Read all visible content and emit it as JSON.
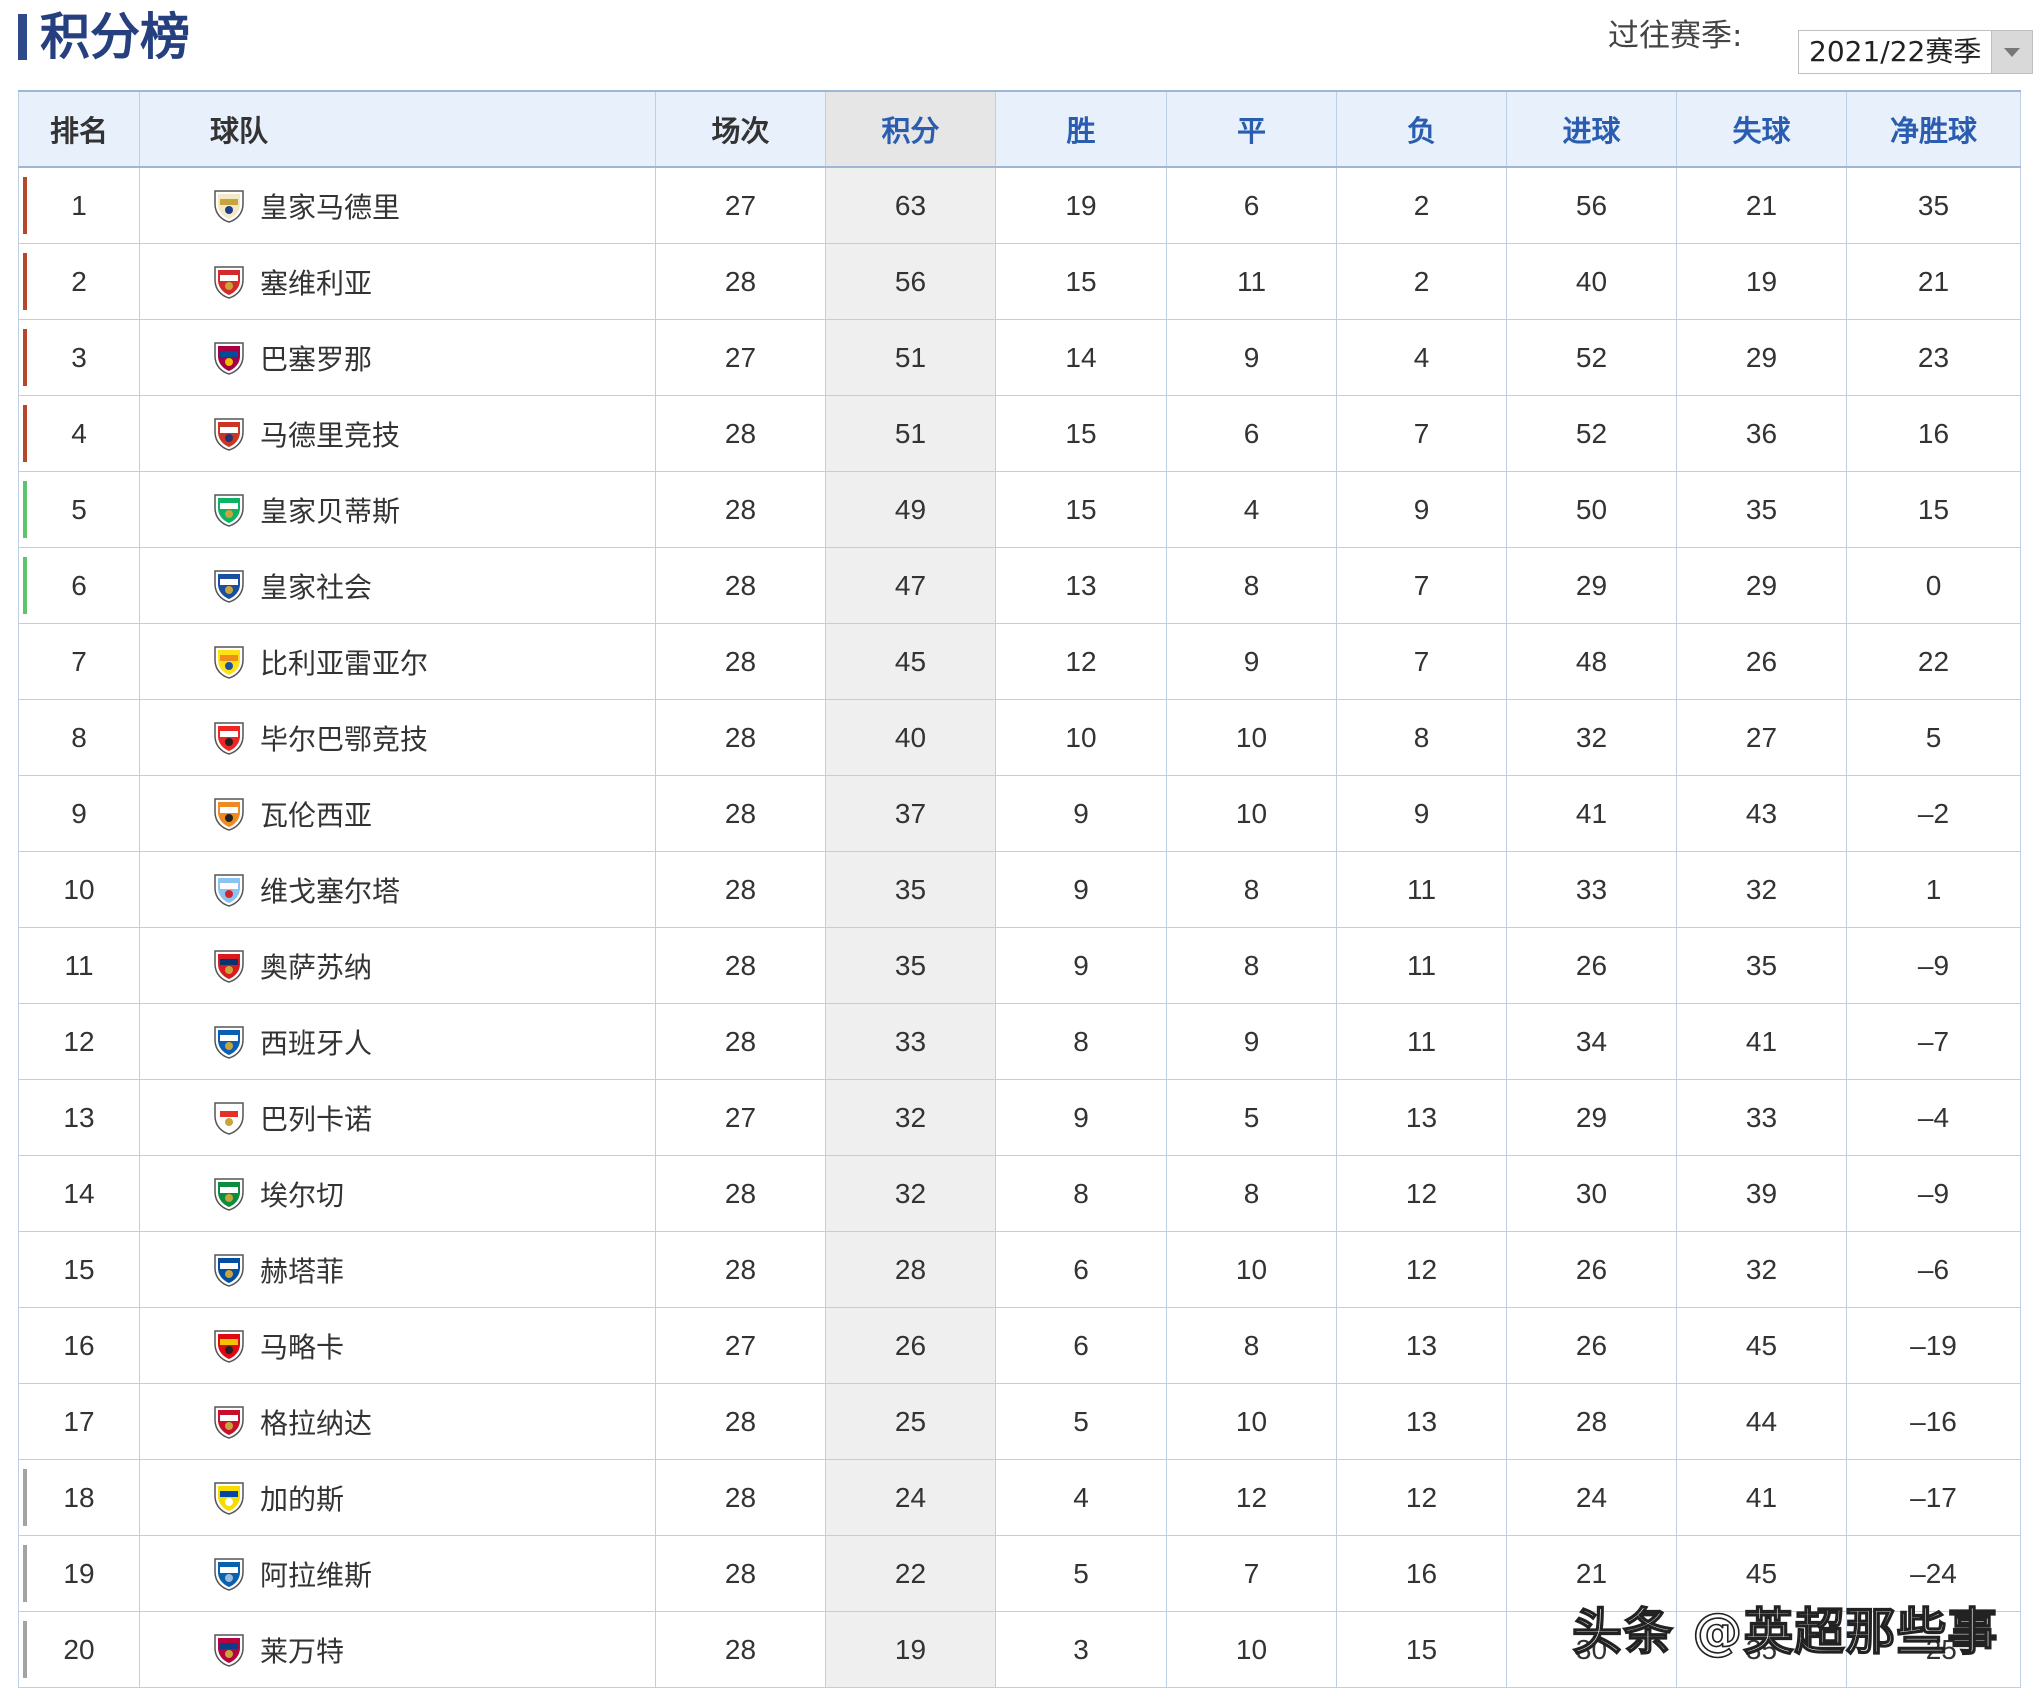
{
  "page": {
    "title": "积分榜",
    "season_label": "过往赛季:",
    "season_value": "2021/22赛季",
    "watermark": "头条 @英超那些事"
  },
  "colors": {
    "ucl": "#b5482b",
    "europa": "#5cc46a",
    "relegation": "#a3a3a3",
    "header_text": "#2a5db0",
    "title": "#253f7f"
  },
  "headers": [
    "排名",
    "球队",
    "场次",
    "积分",
    "胜",
    "平",
    "负",
    "进球",
    "失球",
    "净胜球"
  ],
  "rows": [
    {
      "rank": "1",
      "team": "皇家马德里",
      "played": "27",
      "pts": "63",
      "w": "19",
      "d": "6",
      "l": "2",
      "gf": "56",
      "ga": "21",
      "gd": "35",
      "zone": "ucl",
      "crest": "real-madrid-crest"
    },
    {
      "rank": "2",
      "team": "塞维利亚",
      "played": "28",
      "pts": "56",
      "w": "15",
      "d": "11",
      "l": "2",
      "gf": "40",
      "ga": "19",
      "gd": "21",
      "zone": "ucl",
      "crest": "sevilla-crest"
    },
    {
      "rank": "3",
      "team": "巴塞罗那",
      "played": "27",
      "pts": "51",
      "w": "14",
      "d": "9",
      "l": "4",
      "gf": "52",
      "ga": "29",
      "gd": "23",
      "zone": "ucl",
      "crest": "barcelona-crest"
    },
    {
      "rank": "4",
      "team": "马德里竞技",
      "played": "28",
      "pts": "51",
      "w": "15",
      "d": "6",
      "l": "7",
      "gf": "52",
      "ga": "36",
      "gd": "16",
      "zone": "ucl",
      "crest": "atletico-crest"
    },
    {
      "rank": "5",
      "team": "皇家贝蒂斯",
      "played": "28",
      "pts": "49",
      "w": "15",
      "d": "4",
      "l": "9",
      "gf": "50",
      "ga": "35",
      "gd": "15",
      "zone": "europa",
      "crest": "betis-crest"
    },
    {
      "rank": "6",
      "team": "皇家社会",
      "played": "28",
      "pts": "47",
      "w": "13",
      "d": "8",
      "l": "7",
      "gf": "29",
      "ga": "29",
      "gd": "0",
      "zone": "europa",
      "crest": "real-sociedad-crest"
    },
    {
      "rank": "7",
      "team": "比利亚雷亚尔",
      "played": "28",
      "pts": "45",
      "w": "12",
      "d": "9",
      "l": "7",
      "gf": "48",
      "ga": "26",
      "gd": "22",
      "zone": "",
      "crest": "villarreal-crest"
    },
    {
      "rank": "8",
      "team": "毕尔巴鄂竞技",
      "played": "28",
      "pts": "40",
      "w": "10",
      "d": "10",
      "l": "8",
      "gf": "32",
      "ga": "27",
      "gd": "5",
      "zone": "",
      "crest": "athletic-bilbao-crest"
    },
    {
      "rank": "9",
      "team": "瓦伦西亚",
      "played": "28",
      "pts": "37",
      "w": "9",
      "d": "10",
      "l": "9",
      "gf": "41",
      "ga": "43",
      "gd": "–2",
      "zone": "",
      "crest": "valencia-crest"
    },
    {
      "rank": "10",
      "team": "维戈塞尔塔",
      "played": "28",
      "pts": "35",
      "w": "9",
      "d": "8",
      "l": "11",
      "gf": "33",
      "ga": "32",
      "gd": "1",
      "zone": "",
      "crest": "celta-crest"
    },
    {
      "rank": "11",
      "team": "奥萨苏纳",
      "played": "28",
      "pts": "35",
      "w": "9",
      "d": "8",
      "l": "11",
      "gf": "26",
      "ga": "35",
      "gd": "–9",
      "zone": "",
      "crest": "osasuna-crest"
    },
    {
      "rank": "12",
      "team": "西班牙人",
      "played": "28",
      "pts": "33",
      "w": "8",
      "d": "9",
      "l": "11",
      "gf": "34",
      "ga": "41",
      "gd": "–7",
      "zone": "",
      "crest": "espanyol-crest"
    },
    {
      "rank": "13",
      "team": "巴列卡诺",
      "played": "27",
      "pts": "32",
      "w": "9",
      "d": "5",
      "l": "13",
      "gf": "29",
      "ga": "33",
      "gd": "–4",
      "zone": "",
      "crest": "rayo-crest"
    },
    {
      "rank": "14",
      "team": "埃尔切",
      "played": "28",
      "pts": "32",
      "w": "8",
      "d": "8",
      "l": "12",
      "gf": "30",
      "ga": "39",
      "gd": "–9",
      "zone": "",
      "crest": "elche-crest"
    },
    {
      "rank": "15",
      "team": "赫塔菲",
      "played": "28",
      "pts": "28",
      "w": "6",
      "d": "10",
      "l": "12",
      "gf": "26",
      "ga": "32",
      "gd": "–6",
      "zone": "",
      "crest": "getafe-crest"
    },
    {
      "rank": "16",
      "team": "马略卡",
      "played": "27",
      "pts": "26",
      "w": "6",
      "d": "8",
      "l": "13",
      "gf": "26",
      "ga": "45",
      "gd": "–19",
      "zone": "",
      "crest": "mallorca-crest"
    },
    {
      "rank": "17",
      "team": "格拉纳达",
      "played": "28",
      "pts": "25",
      "w": "5",
      "d": "10",
      "l": "13",
      "gf": "28",
      "ga": "44",
      "gd": "–16",
      "zone": "",
      "crest": "granada-crest"
    },
    {
      "rank": "18",
      "team": "加的斯",
      "played": "28",
      "pts": "24",
      "w": "4",
      "d": "12",
      "l": "12",
      "gf": "24",
      "ga": "41",
      "gd": "–17",
      "zone": "relegation",
      "crest": "cadiz-crest"
    },
    {
      "rank": "19",
      "team": "阿拉维斯",
      "played": "28",
      "pts": "22",
      "w": "5",
      "d": "7",
      "l": "16",
      "gf": "21",
      "ga": "45",
      "gd": "–24",
      "zone": "relegation",
      "crest": "alaves-crest"
    },
    {
      "rank": "20",
      "team": "莱万特",
      "played": "28",
      "pts": "19",
      "w": "3",
      "d": "10",
      "l": "15",
      "gf": "30",
      "ga": "35",
      "gd": "–25",
      "zone": "relegation",
      "crest": "levante-crest"
    }
  ]
}
